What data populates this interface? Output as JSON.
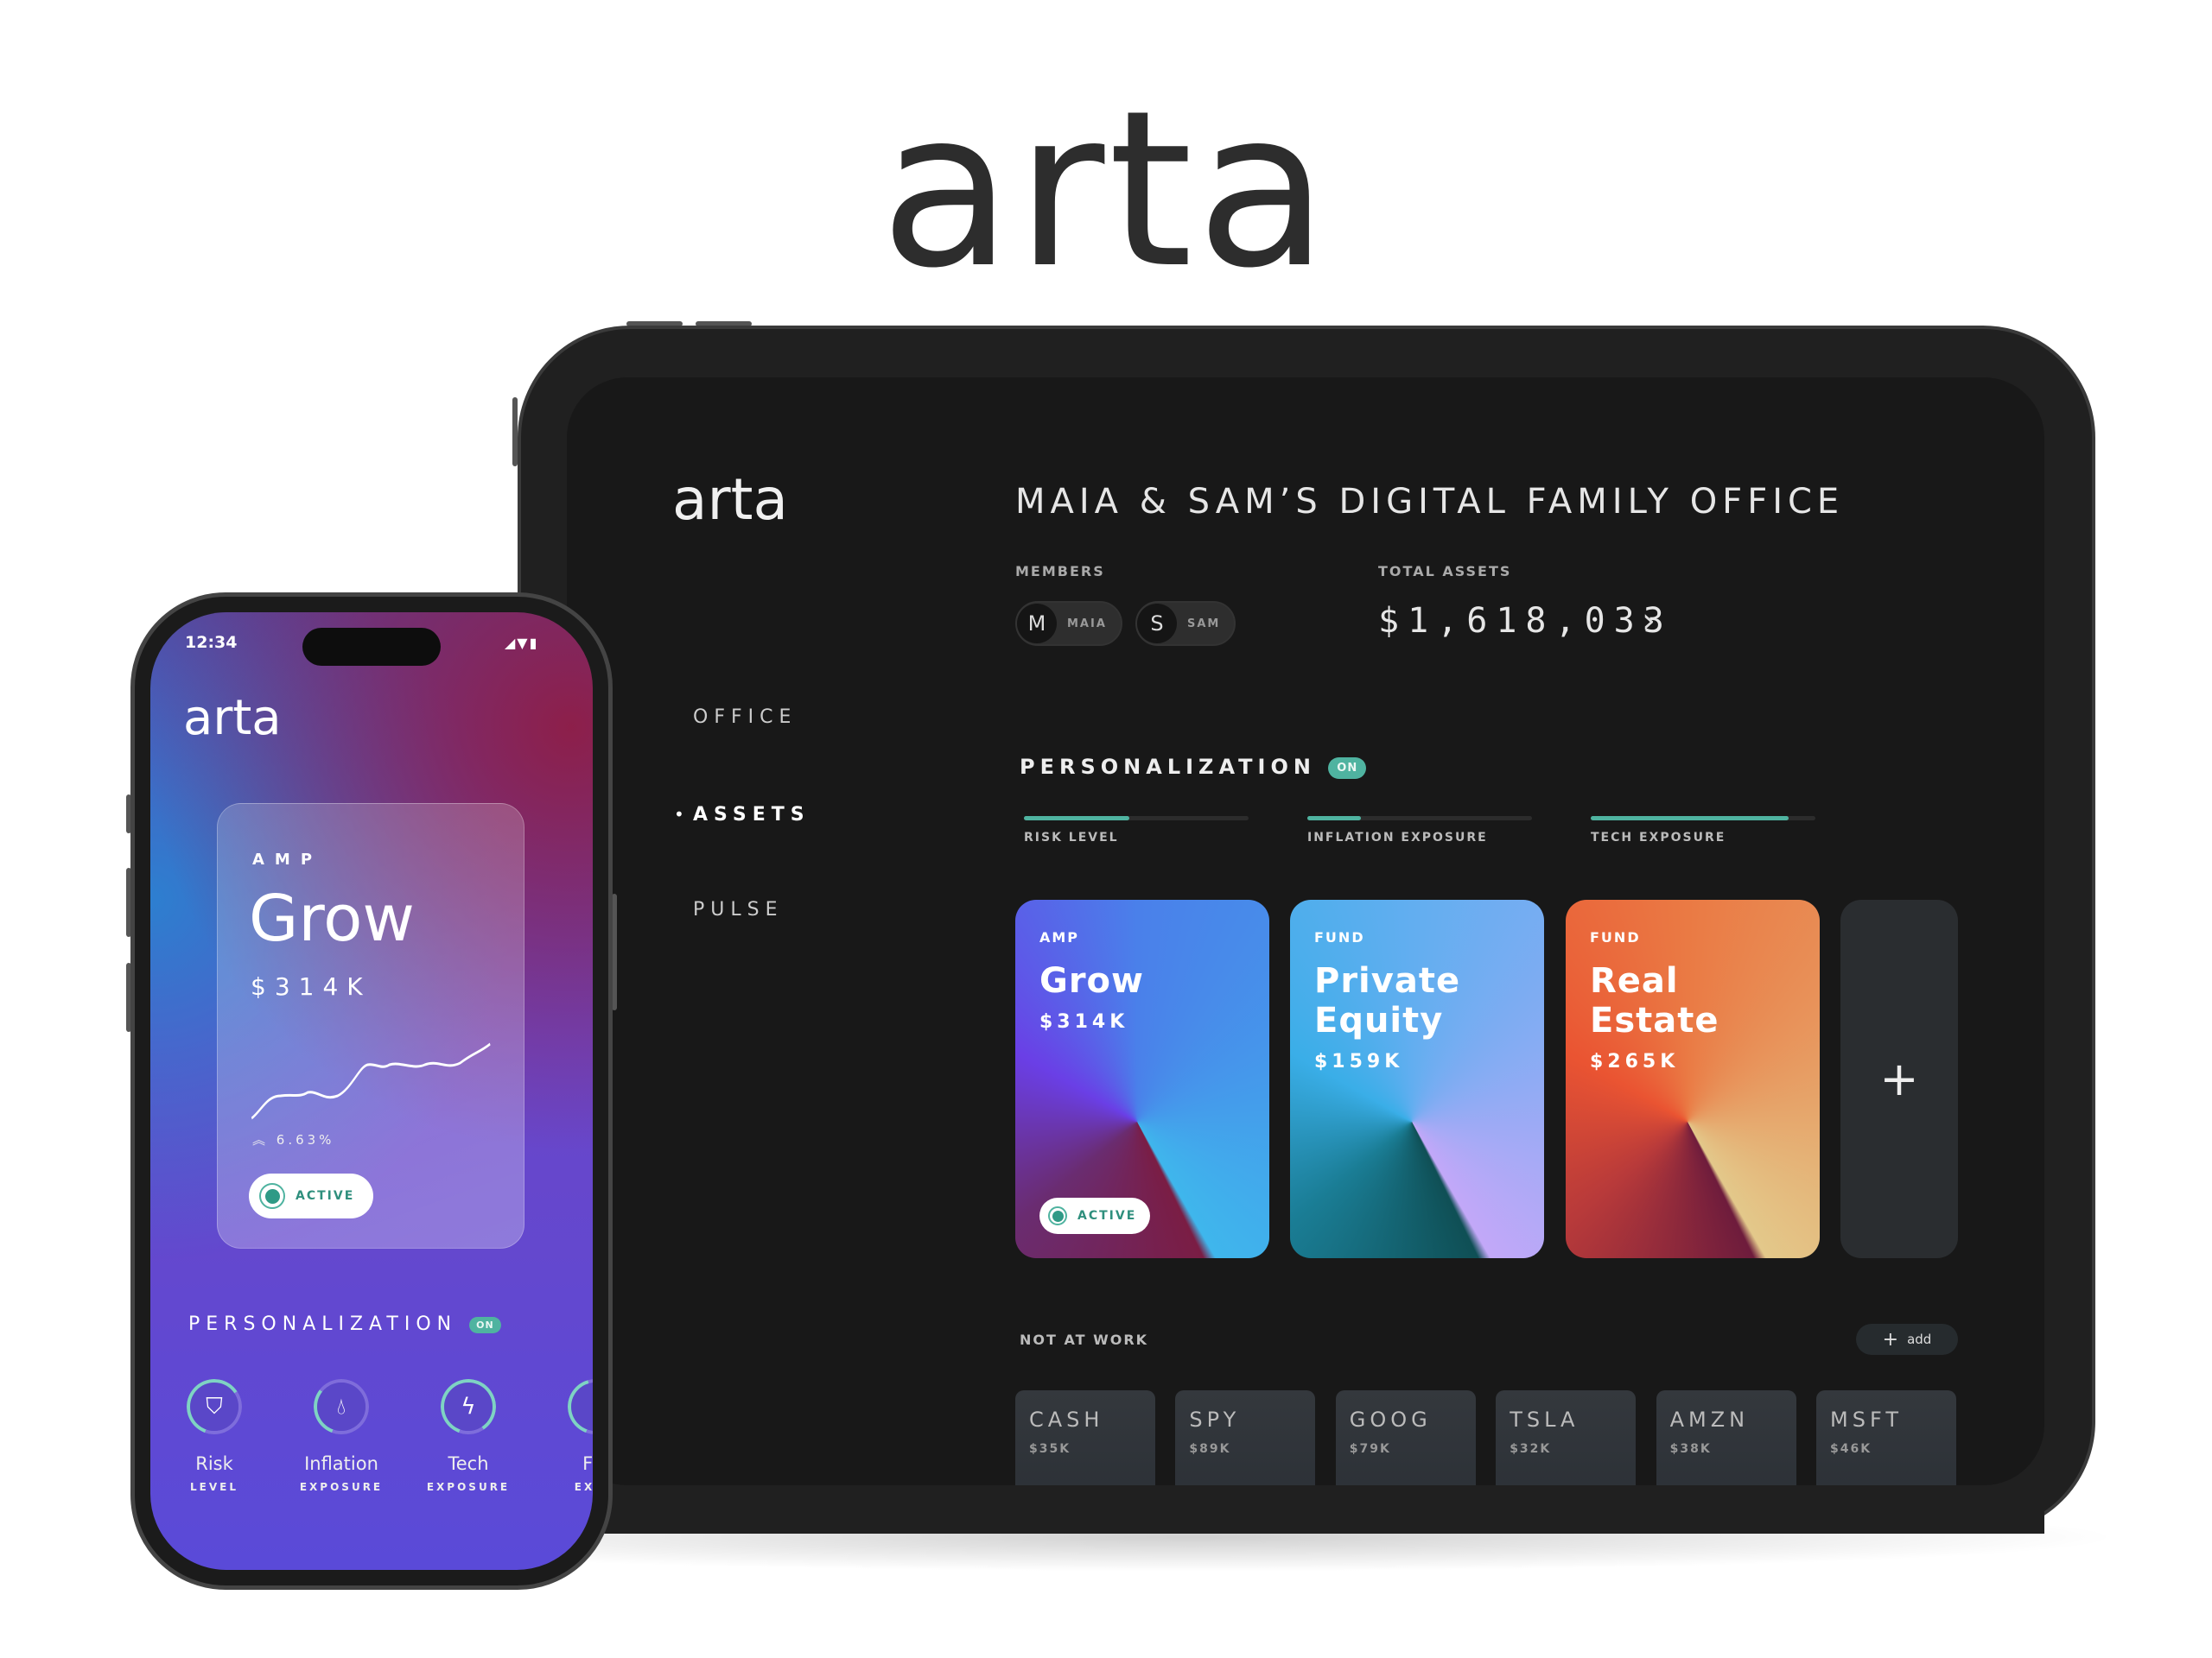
{
  "brand": "arta",
  "tablet": {
    "logo": "arta",
    "title": "MAIA & SAM’S DIGITAL FAMILY OFFICE",
    "members_label": "MEMBERS",
    "members": [
      {
        "initial": "M",
        "name": "MAIA"
      },
      {
        "initial": "S",
        "name": "SAM"
      }
    ],
    "total_assets_label": "TOTAL ASSETS",
    "total_assets": "$1,618,033",
    "total_chevron": "›",
    "nav": [
      {
        "label": "OFFICE",
        "active": false
      },
      {
        "label": "ASSETS",
        "active": true
      },
      {
        "label": "PULSE",
        "active": false
      }
    ],
    "nav_bullet": "•",
    "personalization": {
      "label": "PERSONALIZATION",
      "badge": "ON",
      "bars": [
        {
          "label": "RISK LEVEL",
          "percent": 47
        },
        {
          "label": "INFLATION EXPOSURE",
          "percent": 24
        },
        {
          "label": "TECH EXPOSURE",
          "percent": 88
        }
      ],
      "accent": "#4fb3a0"
    },
    "cards": [
      {
        "type": "AMP",
        "name": "Grow",
        "amount": "$314K",
        "status": "ACTIVE"
      },
      {
        "type": "FUND",
        "name": "Private Equity",
        "amount": "$159K"
      },
      {
        "type": "FUND",
        "name": "Real Estate",
        "amount": "$265K"
      }
    ],
    "add_card_icon": "+",
    "not_at_work": {
      "label": "NOT AT WORK",
      "add_label": "add",
      "add_icon": "+",
      "tiles": [
        {
          "symbol": "CASH",
          "value": "$35K"
        },
        {
          "symbol": "SPY",
          "value": "$89K"
        },
        {
          "symbol": "GOOG",
          "value": "$79K"
        },
        {
          "symbol": "TSLA",
          "value": "$32K"
        },
        {
          "symbol": "AMZN",
          "value": "$38K"
        },
        {
          "symbol": "MSFT",
          "value": "$46K"
        }
      ]
    }
  },
  "phone": {
    "time": "12:34",
    "logo": "arta",
    "card": {
      "type": "AMP",
      "name": "Grow",
      "amount": "$314K",
      "change": "6.63%",
      "status": "ACTIVE"
    },
    "personalization": {
      "label": "PERSONALIZATION",
      "badge": "ON",
      "items": [
        {
          "label": "Risk",
          "sub": "LEVEL",
          "icon": "shield-icon",
          "percent": 60
        },
        {
          "label": "Inflation",
          "sub": "EXPOSURE",
          "icon": "drop-icon",
          "percent": 30
        },
        {
          "label": "Tech",
          "sub": "EXPOSURE",
          "icon": "bolt-icon",
          "percent": 85
        },
        {
          "label": "Fin",
          "sub": "EXPO",
          "icon": "partial-icon",
          "percent": 40
        }
      ]
    }
  }
}
